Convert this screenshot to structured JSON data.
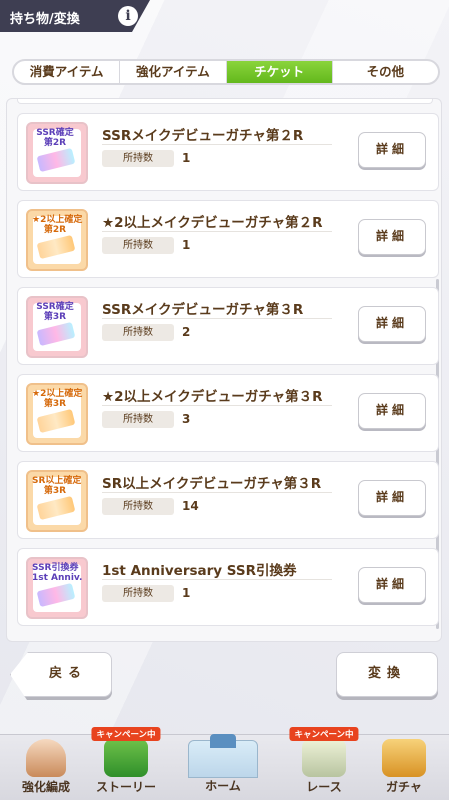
{
  "header": {
    "title": "持ち物/変換",
    "info_icon": "i"
  },
  "tabs": [
    {
      "label": "消費アイテム",
      "active": false
    },
    {
      "label": "強化アイテム",
      "active": false
    },
    {
      "label": "チケット",
      "active": true
    },
    {
      "label": "その他",
      "active": false
    }
  ],
  "items": [
    {
      "name": "SSRメイクデビューガチャ第２R",
      "count_label": "所持数",
      "count": "1",
      "badge": "SSR確定\n第2R",
      "color": "pink",
      "detail": "詳細"
    },
    {
      "name": "★2以上メイクデビューガチャ第２R",
      "count_label": "所持数",
      "count": "1",
      "badge": "★2以上確定\n第2R",
      "color": "orange",
      "detail": "詳細"
    },
    {
      "name": "SSRメイクデビューガチャ第３R",
      "count_label": "所持数",
      "count": "2",
      "badge": "SSR確定\n第3R",
      "color": "pink",
      "detail": "詳細"
    },
    {
      "name": "★2以上メイクデビューガチャ第３R",
      "count_label": "所持数",
      "count": "3",
      "badge": "★2以上確定\n第3R",
      "color": "orange",
      "detail": "詳細"
    },
    {
      "name": "SR以上メイクデビューガチャ第３R",
      "count_label": "所持数",
      "count": "14",
      "badge": "SR以上確定\n第3R",
      "color": "orange",
      "detail": "詳細"
    },
    {
      "name": "1st Anniversary SSR引換券",
      "count_label": "所持数",
      "count": "1",
      "badge": "SSR引換券\n1st Anniv.",
      "color": "pink",
      "detail": "詳細"
    }
  ],
  "buttons": {
    "back": "戻る",
    "exchange": "変換"
  },
  "nav": [
    {
      "label": "強化編成",
      "campaign": ""
    },
    {
      "label": "ストーリー",
      "campaign": "キャンペーン中"
    },
    {
      "label": "ホーム",
      "campaign": ""
    },
    {
      "label": "レース",
      "campaign": "キャンペーン中"
    },
    {
      "label": "ガチャ",
      "campaign": ""
    }
  ],
  "colors": {
    "active_tab": "#7cc82e",
    "header_bg": "#3e3e52",
    "text": "#5a3b1c"
  }
}
